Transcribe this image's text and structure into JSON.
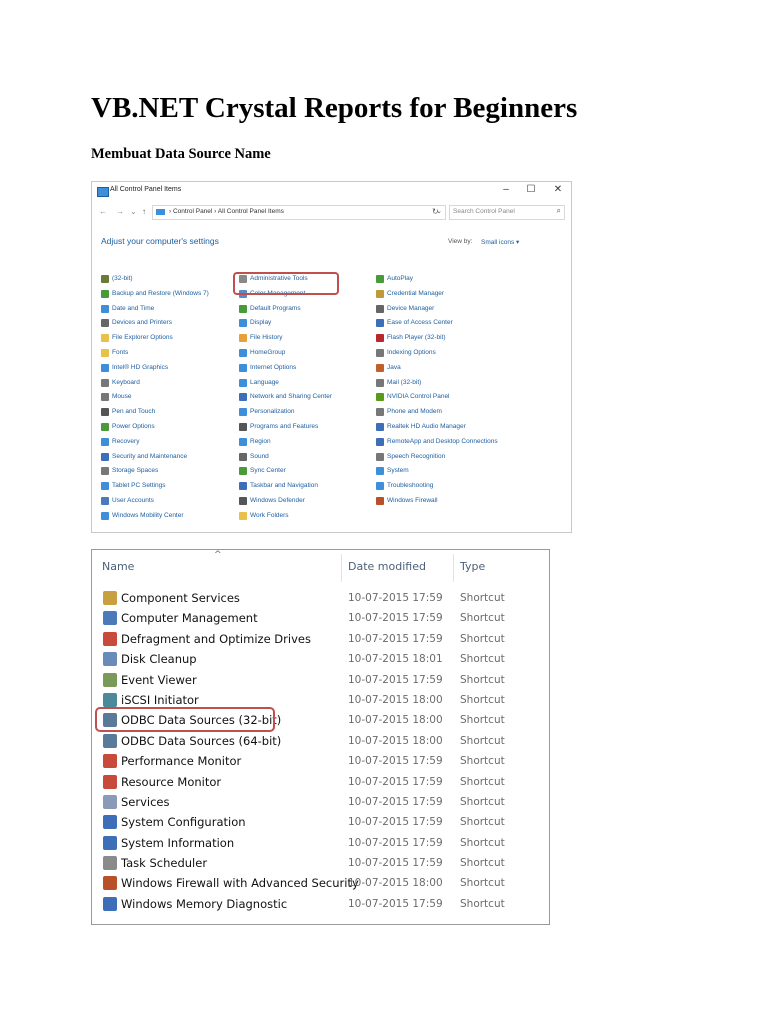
{
  "doc": {
    "title": "VB.NET Crystal Reports for Beginners",
    "subtitle": "Membuat Data Source Name"
  },
  "control_panel": {
    "window_title": "All Control Panel Items",
    "buttons": {
      "minimize": "–",
      "maximize": "☐",
      "close": "✕"
    },
    "nav": {
      "back": "←",
      "forward": "→",
      "recent": "⌄",
      "up": "↑"
    },
    "address": "› Control Panel › All Control Panel Items",
    "address_dropdown": "⌄",
    "refresh": "↻",
    "search_placeholder": "Search Control Panel",
    "search_icon_glyph": "⌕",
    "heading": "Adjust your computer's settings",
    "view_by_label": "View by:",
    "view_by_value": "Small icons ▾",
    "highlight_color": "#c0504d",
    "link_color": "#1e5fa0",
    "columns": [
      [
        {
          "label": "(32-bit)",
          "icon": "app-icon",
          "color": "#6a7a3a"
        },
        {
          "label": "Backup and Restore (Windows 7)",
          "icon": "backup-icon",
          "color": "#4a9a3a"
        },
        {
          "label": "Date and Time",
          "icon": "clock-icon",
          "color": "#3c8fd8"
        },
        {
          "label": "Devices and Printers",
          "icon": "printer-icon",
          "color": "#666666"
        },
        {
          "label": "File Explorer Options",
          "icon": "folder-icon",
          "color": "#e8c04a"
        },
        {
          "label": "Fonts",
          "icon": "font-icon",
          "color": "#e8c04a"
        },
        {
          "label": "Intel® HD Graphics",
          "icon": "display-icon",
          "color": "#3c8fd8"
        },
        {
          "label": "Keyboard",
          "icon": "keyboard-icon",
          "color": "#777777"
        },
        {
          "label": "Mouse",
          "icon": "mouse-icon",
          "color": "#777777"
        },
        {
          "label": "Pen and Touch",
          "icon": "pen-icon",
          "color": "#555555"
        },
        {
          "label": "Power Options",
          "icon": "power-icon",
          "color": "#4a9a3a"
        },
        {
          "label": "Recovery",
          "icon": "recovery-icon",
          "color": "#3c8fd8"
        },
        {
          "label": "Security and Maintenance",
          "icon": "flag-icon",
          "color": "#3c6fb8"
        },
        {
          "label": "Storage Spaces",
          "icon": "storage-icon",
          "color": "#777777"
        },
        {
          "label": "Tablet PC Settings",
          "icon": "tablet-icon",
          "color": "#3c8fd8"
        },
        {
          "label": "User Accounts",
          "icon": "users-icon",
          "color": "#4a7ab8"
        },
        {
          "label": "Windows Mobility Center",
          "icon": "mobility-icon",
          "color": "#3c8fd8"
        }
      ],
      [
        {
          "label": "Administrative Tools",
          "icon": "tools-icon",
          "color": "#888888"
        },
        {
          "label": "Color Management",
          "icon": "color-icon",
          "color": "#5a8ac8"
        },
        {
          "label": "Default Programs",
          "icon": "programs-icon",
          "color": "#4a9a3a"
        },
        {
          "label": "Display",
          "icon": "display-icon",
          "color": "#3c8fd8"
        },
        {
          "label": "File History",
          "icon": "history-icon",
          "color": "#e8a03a"
        },
        {
          "label": "HomeGroup",
          "icon": "homegroup-icon",
          "color": "#3c8fd8"
        },
        {
          "label": "Internet Options",
          "icon": "globe-icon",
          "color": "#3c8fd8"
        },
        {
          "label": "Language",
          "icon": "language-icon",
          "color": "#3c8fd8"
        },
        {
          "label": "Network and Sharing Center",
          "icon": "network-icon",
          "color": "#3c6fb8"
        },
        {
          "label": "Personalization",
          "icon": "personalize-icon",
          "color": "#3c8fd8"
        },
        {
          "label": "Programs and Features",
          "icon": "features-icon",
          "color": "#555555"
        },
        {
          "label": "Region",
          "icon": "region-icon",
          "color": "#3c8fd8"
        },
        {
          "label": "Sound",
          "icon": "speaker-icon",
          "color": "#666666"
        },
        {
          "label": "Sync Center",
          "icon": "sync-icon",
          "color": "#4a9a3a"
        },
        {
          "label": "Taskbar and Navigation",
          "icon": "taskbar-icon",
          "color": "#3c6fb8"
        },
        {
          "label": "Windows Defender",
          "icon": "defender-icon",
          "color": "#555555"
        },
        {
          "label": "Work Folders",
          "icon": "workfolder-icon",
          "color": "#e8c04a"
        }
      ],
      [
        {
          "label": "AutoPlay",
          "icon": "autoplay-icon",
          "color": "#4a9a3a"
        },
        {
          "label": "Credential Manager",
          "icon": "credential-icon",
          "color": "#c09a3a"
        },
        {
          "label": "Device Manager",
          "icon": "device-icon",
          "color": "#666666"
        },
        {
          "label": "Ease of Access Center",
          "icon": "access-icon",
          "color": "#3c6fb8"
        },
        {
          "label": "Flash Player (32-bit)",
          "icon": "flash-icon",
          "color": "#b8282a"
        },
        {
          "label": "Indexing Options",
          "icon": "indexing-icon",
          "color": "#777777"
        },
        {
          "label": "Java",
          "icon": "java-icon",
          "color": "#c0602a"
        },
        {
          "label": "Mail (32-bit)",
          "icon": "mail-icon",
          "color": "#777777"
        },
        {
          "label": "NVIDIA Control Panel",
          "icon": "nvidia-icon",
          "color": "#5a9a1a"
        },
        {
          "label": "Phone and Modem",
          "icon": "phone-icon",
          "color": "#777777"
        },
        {
          "label": "Realtek HD Audio Manager",
          "icon": "audio-icon",
          "color": "#3c6fb8"
        },
        {
          "label": "RemoteApp and Desktop Connections",
          "icon": "remote-icon",
          "color": "#3c6fb8"
        },
        {
          "label": "Speech Recognition",
          "icon": "mic-icon",
          "color": "#777777"
        },
        {
          "label": "System",
          "icon": "system-icon",
          "color": "#3c8fd8"
        },
        {
          "label": "Troubleshooting",
          "icon": "troubleshoot-icon",
          "color": "#3c8fd8"
        },
        {
          "label": "Windows Firewall",
          "icon": "firewall-icon",
          "color": "#b8502a"
        }
      ]
    ]
  },
  "explorer": {
    "sort_indicator": "^",
    "headers": {
      "name": "Name",
      "date": "Date modified",
      "type": "Type"
    },
    "rows": [
      {
        "name": "Component Services",
        "date": "10-07-2015 17:59",
        "type": "Shortcut",
        "icon": "component-services-icon",
        "color": "#c8a040"
      },
      {
        "name": "Computer Management",
        "date": "10-07-2015 17:59",
        "type": "Shortcut",
        "icon": "computer-management-icon",
        "color": "#4a7ab8"
      },
      {
        "name": "Defragment and Optimize Drives",
        "date": "10-07-2015 17:59",
        "type": "Shortcut",
        "icon": "defragment-icon",
        "color": "#c84a3a"
      },
      {
        "name": "Disk Cleanup",
        "date": "10-07-2015 18:01",
        "type": "Shortcut",
        "icon": "disk-cleanup-icon",
        "color": "#6a8ab8"
      },
      {
        "name": "Event Viewer",
        "date": "10-07-2015 17:59",
        "type": "Shortcut",
        "icon": "event-viewer-icon",
        "color": "#7a9a5a"
      },
      {
        "name": "iSCSI Initiator",
        "date": "10-07-2015 18:00",
        "type": "Shortcut",
        "icon": "iscsi-icon",
        "color": "#4a8a9a"
      },
      {
        "name": "ODBC Data Sources (32-bit)",
        "date": "10-07-2015 18:00",
        "type": "Shortcut",
        "icon": "odbc-icon",
        "color": "#5a7a9a"
      },
      {
        "name": "ODBC Data Sources (64-bit)",
        "date": "10-07-2015 18:00",
        "type": "Shortcut",
        "icon": "odbc-icon",
        "color": "#5a7a9a"
      },
      {
        "name": "Performance Monitor",
        "date": "10-07-2015 17:59",
        "type": "Shortcut",
        "icon": "performance-icon",
        "color": "#c84a3a"
      },
      {
        "name": "Resource Monitor",
        "date": "10-07-2015 17:59",
        "type": "Shortcut",
        "icon": "resource-monitor-icon",
        "color": "#c84a3a"
      },
      {
        "name": "Services",
        "date": "10-07-2015 17:59",
        "type": "Shortcut",
        "icon": "services-icon",
        "color": "#8a9ab8"
      },
      {
        "name": "System Configuration",
        "date": "10-07-2015 17:59",
        "type": "Shortcut",
        "icon": "system-configuration-icon",
        "color": "#3c6fb8"
      },
      {
        "name": "System Information",
        "date": "10-07-2015 17:59",
        "type": "Shortcut",
        "icon": "system-information-icon",
        "color": "#3c6fb8"
      },
      {
        "name": "Task Scheduler",
        "date": "10-07-2015 17:59",
        "type": "Shortcut",
        "icon": "task-scheduler-icon",
        "color": "#8a8a8a"
      },
      {
        "name": "Windows Firewall with Advanced Security",
        "date": "10-07-2015 18:00",
        "type": "Shortcut",
        "icon": "firewall-icon",
        "color": "#b8502a"
      },
      {
        "name": "Windows Memory Diagnostic",
        "date": "10-07-2015 17:59",
        "type": "Shortcut",
        "icon": "memory-diagnostic-icon",
        "color": "#3c6fb8"
      }
    ]
  }
}
